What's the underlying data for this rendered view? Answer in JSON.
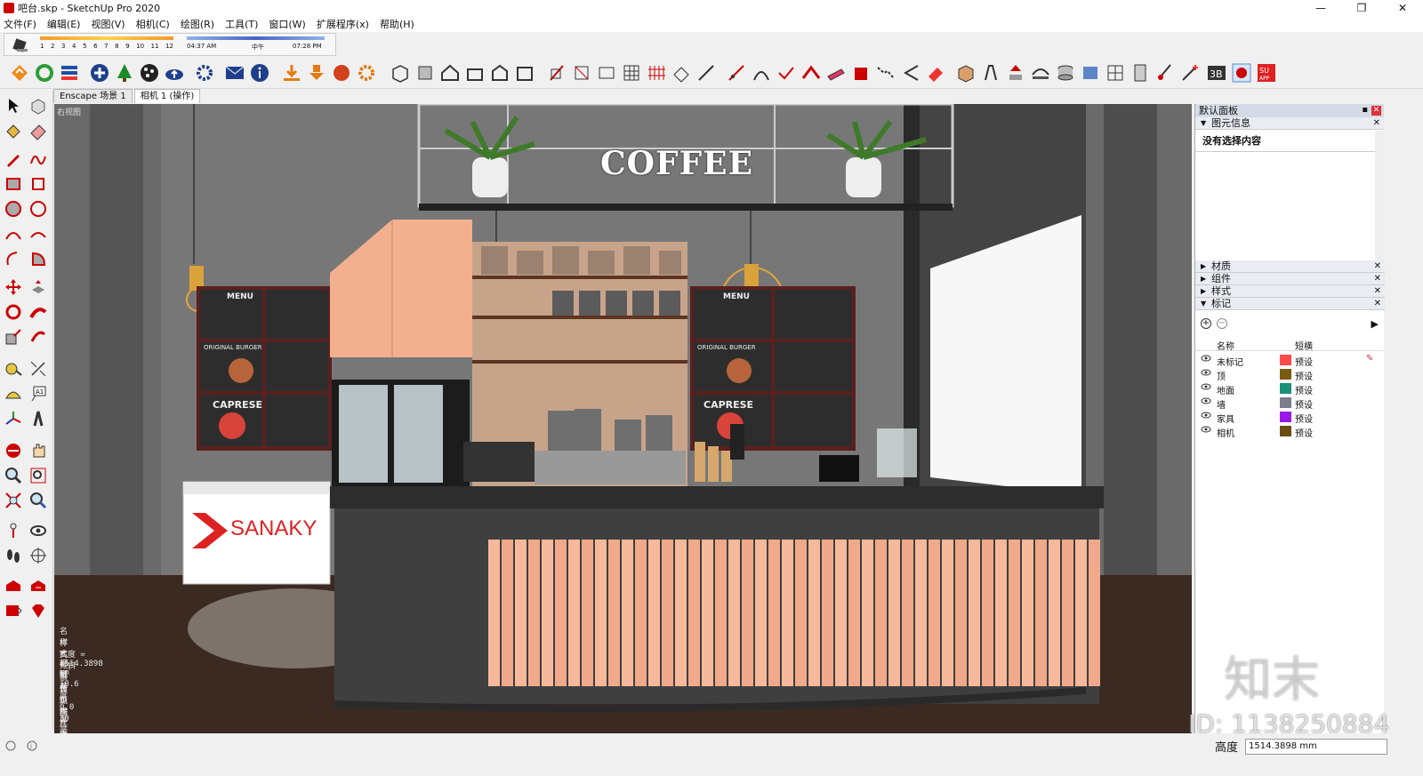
{
  "window": {
    "title": "吧台.skp - SketchUp Pro 2020"
  },
  "menu": [
    "文件(F)",
    "编辑(E)",
    "视图(V)",
    "相机(C)",
    "绘图(R)",
    "工具(T)",
    "窗口(W)",
    "扩展程序(x)",
    "帮助(H)"
  ],
  "shadow": {
    "months": [
      "1",
      "2",
      "3",
      "4",
      "5",
      "6",
      "7",
      "8",
      "9",
      "10",
      "11",
      "12"
    ],
    "time_start": "04:37 AM",
    "noon": "中午",
    "time_end": "07:28 PM"
  },
  "tabs": [
    "Enscape 场景 1",
    "相机 1 (操作)"
  ],
  "viewport": {
    "view_label": "右视图",
    "coffee_sign": "COFFEE",
    "freezer_brand": "SANAKY",
    "menu_board_titles": [
      "MENU",
      "ORIGINAL BURGER",
      "CAPRESE"
    ],
    "camera_info": [
      "名称 = 相机 1",
      "样式 = 屏幕",
      "高度 = 1514.3898 mm",
      "倾斜 = -0.6 度",
      "滚转 = 0.0 度",
      "焦距 = 30 毫米",
      "纵横比 = 屏幕",
      "图片宽度 = 屏幕"
    ],
    "watermark_brand": "知末",
    "watermark_id": "ID: 1138250884"
  },
  "right_panel": {
    "title": "默认面板",
    "entity_info": {
      "header": "图元信息",
      "message": "没有选择内容"
    },
    "sections": [
      "材质",
      "组件",
      "样式",
      "标记"
    ],
    "tag_columns": {
      "name": "名称",
      "dash": "短横"
    },
    "tags": [
      {
        "name": "未标记",
        "color": "#ff4b4b",
        "dash": "预设"
      },
      {
        "name": "顶",
        "color": "#7a5a10",
        "dash": "预设"
      },
      {
        "name": "地面",
        "color": "#1b8f7a",
        "dash": "预设"
      },
      {
        "name": "墙",
        "color": "#7b7d8f",
        "dash": "预设"
      },
      {
        "name": "家具",
        "color": "#9b19e8",
        "dash": "预设"
      },
      {
        "name": "相机",
        "color": "#6b4c12",
        "dash": "预设"
      }
    ]
  },
  "status": {
    "vcb_label": "高度",
    "vcb_value": "1514.3898 mm"
  }
}
